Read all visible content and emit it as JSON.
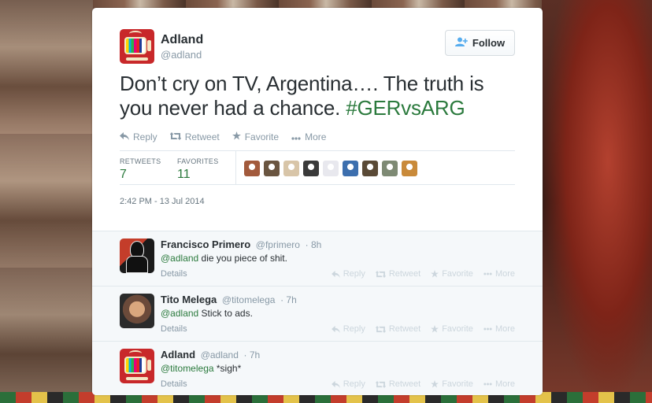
{
  "tweet": {
    "user_name": "Adland",
    "user_handle": "@adland",
    "follow_label": "Follow",
    "text_main": "Don’t cry on TV, Argentina…. The truth is you never had a chance. ",
    "hashtag": "#GERvsARG",
    "actions": {
      "reply": "Reply",
      "retweet": "Retweet",
      "favorite": "Favorite",
      "more": "More"
    },
    "stats": {
      "retweets_label": "RETWEETS",
      "retweets_count": "7",
      "favorites_label": "FAVORITES",
      "favorites_count": "11"
    },
    "favoriter_avatar_colors": [
      "#a25a3c",
      "#6a5540",
      "#d8c5a8",
      "#3a3a3a",
      "#e8e8ee",
      "#3c6fae",
      "#5a4a36",
      "#7e8a74",
      "#c98a3a"
    ],
    "timestamp": "2:42 PM - 13 Jul 2014"
  },
  "replies": [
    {
      "name": "Francisco Primero",
      "handle": "@fprimero",
      "time": "· 8h",
      "mention": "@adland",
      "text": " die you piece of shit.",
      "details": "Details"
    },
    {
      "name": "Tito Melega",
      "handle": "@titomelega",
      "time": "· 7h",
      "mention": "@adland",
      "text": " Stick to ads.",
      "details": "Details"
    },
    {
      "name": "Adland",
      "handle": "@adland",
      "time": "· 7h",
      "mention": "@titomelega",
      "text": " *sigh*",
      "details": "Details"
    }
  ],
  "reply_actions": {
    "reply": "Reply",
    "retweet": "Retweet",
    "favorite": "Favorite",
    "more": "More"
  },
  "icons": {
    "reply": "reply-icon",
    "retweet": "retweet-icon",
    "favorite": "star-icon",
    "more": "more-icon",
    "follow": "add-user-icon"
  },
  "colors": {
    "hashtag": "#2b7a3d",
    "follow_accent": "#55acee"
  }
}
